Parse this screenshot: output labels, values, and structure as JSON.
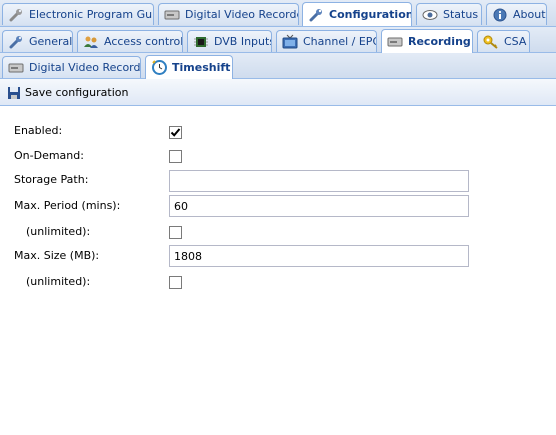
{
  "main_tabs": [
    {
      "label": "Electronic Program Guide",
      "icon": "wrench-icon"
    },
    {
      "label": "Digital Video Recorder",
      "icon": "recorder-icon"
    },
    {
      "label": "Configuration",
      "icon": "wrench-icon",
      "active": true
    },
    {
      "label": "Status",
      "icon": "eye-icon"
    },
    {
      "label": "About",
      "icon": "info-icon"
    }
  ],
  "config_tabs": [
    {
      "label": "General",
      "icon": "wrench-icon"
    },
    {
      "label": "Access control",
      "icon": "users-icon"
    },
    {
      "label": "DVB Inputs",
      "icon": "chip-icon"
    },
    {
      "label": "Channel / EPG",
      "icon": "tv-icon"
    },
    {
      "label": "Recording",
      "icon": "recorder-icon",
      "active": true
    },
    {
      "label": "CSA",
      "icon": "key-icon"
    }
  ],
  "recording_tabs": [
    {
      "label": "Digital Video Recorder",
      "icon": "recorder-icon"
    },
    {
      "label": "Timeshift",
      "icon": "clock-icon",
      "active": true
    }
  ],
  "toolbar": {
    "save_label": "Save configuration",
    "save_icon": "save-icon"
  },
  "form": {
    "enabled": {
      "label": "Enabled:",
      "checked": true
    },
    "on_demand": {
      "label": "On-Demand:",
      "checked": false
    },
    "storage_path": {
      "label": "Storage Path:",
      "value": ""
    },
    "max_period": {
      "label": "Max. Period (mins):",
      "value": "60"
    },
    "max_period_unlimited": {
      "label": "(unlimited):",
      "checked": false
    },
    "max_size": {
      "label": "Max. Size (MB):",
      "value": "1808"
    },
    "max_size_unlimited": {
      "label": "(unlimited):",
      "checked": false
    }
  },
  "colors": {
    "tab_text": "#15428b",
    "border": "#99bbe8",
    "bar_bg": "#cfdcee"
  }
}
